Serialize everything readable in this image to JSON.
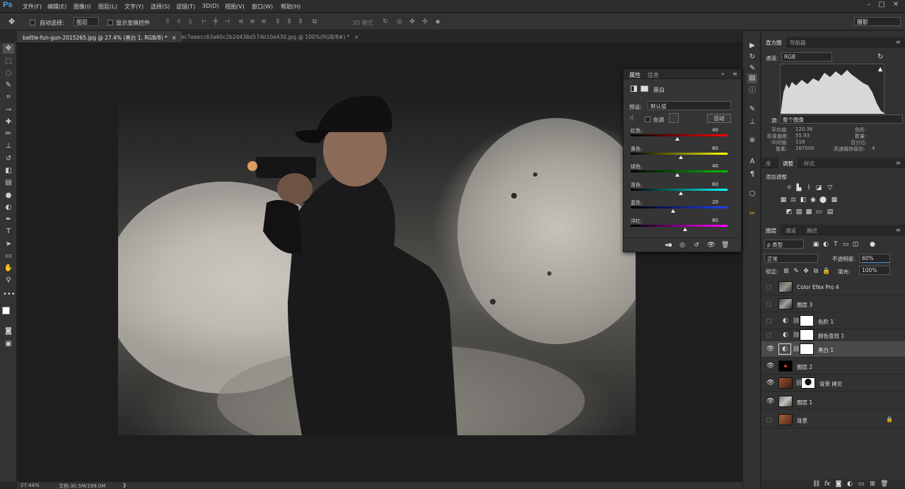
{
  "app": {
    "logo": "Ps"
  },
  "menu": [
    "文件(F)",
    "编辑(E)",
    "图像(I)",
    "图层(L)",
    "文字(Y)",
    "选择(S)",
    "滤镜(T)",
    "3D(D)",
    "视图(V)",
    "窗口(W)",
    "帮助(H)"
  ],
  "window_controls": [
    "–",
    "□",
    "✕"
  ],
  "options": {
    "auto_select_label": "自动选择:",
    "auto_select_value": "图层",
    "show_transform_label": "显示变换控件",
    "mode_3d_label": "3D 模式:",
    "workspace": "摄影"
  },
  "tabs": [
    {
      "label": "battle-fun-gun-2015265.jpg @ 27.4% (黑白 1, RGB/8) *",
      "close": "×"
    },
    {
      "label": "ec7eeecc63a60c2b2d436d574b10e430.jpg @ 100%(RGB/8#) *",
      "close": "×"
    }
  ],
  "status": {
    "zoom": "27.44%",
    "doc": "文档:30.5M/199.0M",
    "arrow": "❯"
  },
  "histogram": {
    "tabs": [
      "直方图",
      "导航器"
    ],
    "channel_label": "通道:",
    "channel_value": "RGB",
    "source_label": "源:",
    "source_value": "整个图像",
    "stats_left": [
      {
        "label": "平均值:",
        "value": "120.36"
      },
      {
        "label": "标准偏差:",
        "value": "55.93"
      },
      {
        "label": "中间值:",
        "value": "118"
      },
      {
        "label": "像素:",
        "value": "167000"
      }
    ],
    "stats_right": [
      {
        "label": "色阶:",
        "value": ""
      },
      {
        "label": "数量:",
        "value": ""
      },
      {
        "label": "百分位:",
        "value": ""
      },
      {
        "label": "高速缓存级别:",
        "value": "4"
      }
    ]
  },
  "adjustments": {
    "tabs": [
      "库",
      "调整",
      "样式"
    ],
    "title": "添加调整"
  },
  "layers_panel": {
    "tabs": [
      "图层",
      "通道",
      "路径"
    ],
    "kind_label": "ρ 类型",
    "blend_mode": "正常",
    "opacity_label": "不透明度:",
    "opacity_value": "60%",
    "lock_label": "锁定:",
    "fill_label": "填充:",
    "fill_value": "100%",
    "layers": [
      {
        "name": "Color Efex Pro 4",
        "visible": false
      },
      {
        "name": "图层 3",
        "visible": false
      },
      {
        "name": "色阶 1",
        "visible": false
      },
      {
        "name": "颜色查找 1",
        "visible": false
      },
      {
        "name": "黑白 1",
        "visible": true,
        "selected": true
      },
      {
        "name": "图层 2",
        "visible": true
      },
      {
        "name": "背景 拷贝",
        "visible": true
      },
      {
        "name": "图层 1",
        "visible": true
      },
      {
        "name": "背景",
        "visible": false,
        "locked": true
      }
    ],
    "footer_icons": [
      "link-icon",
      "fx-icon",
      "mask-icon",
      "adjustment-icon",
      "folder-icon",
      "new-layer-icon",
      "trash-icon"
    ]
  },
  "properties": {
    "tabs": [
      "属性",
      "信息"
    ],
    "title": "黑白",
    "preset_label": "预设:",
    "preset_value": "默认值",
    "tint_label": "色调",
    "auto_label": "自动",
    "sliders": [
      {
        "label": "红色:",
        "value": 40,
        "gradient": "#000000,#ff0000"
      },
      {
        "label": "黄色:",
        "value": 60,
        "gradient": "#000000,#ffff00"
      },
      {
        "label": "绿色:",
        "value": 40,
        "gradient": "#000000,#00c000"
      },
      {
        "label": "青色:",
        "value": 60,
        "gradient": "#000000,#00ffff"
      },
      {
        "label": "蓝色:",
        "value": 20,
        "gradient": "#000000,#2040ff"
      },
      {
        "label": "洋红:",
        "value": 80,
        "gradient": "#000000,#ff00ff"
      }
    ]
  }
}
